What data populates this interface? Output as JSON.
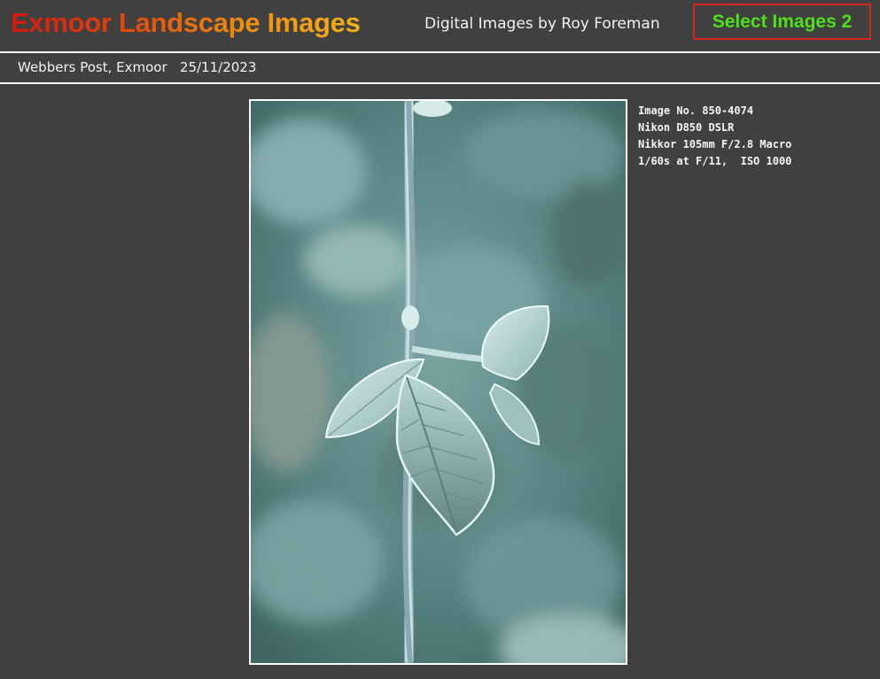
{
  "header": {
    "title": "Exmoor Landscape Images",
    "subtitle": "Digital Images by Roy Foreman",
    "select_button": "Select Images 2"
  },
  "caption": {
    "location": "Webbers Post, Exmoor   25/11/2023"
  },
  "photo": {
    "icon": "frosted-bramble-leaf-photo"
  },
  "exif": {
    "image_no": "Image No. 850-4074",
    "camera": "Nikon D850 DSLR",
    "lens": "Nikkor 105mm F/2.8 Macro",
    "exposure": "1/60s at F/11,  ISO 1000"
  },
  "colors": {
    "background": "#404040",
    "title_start": "#d41a0e",
    "title_end": "#f3b219",
    "button_text": "#4fe018",
    "button_border": "#d8231a"
  }
}
